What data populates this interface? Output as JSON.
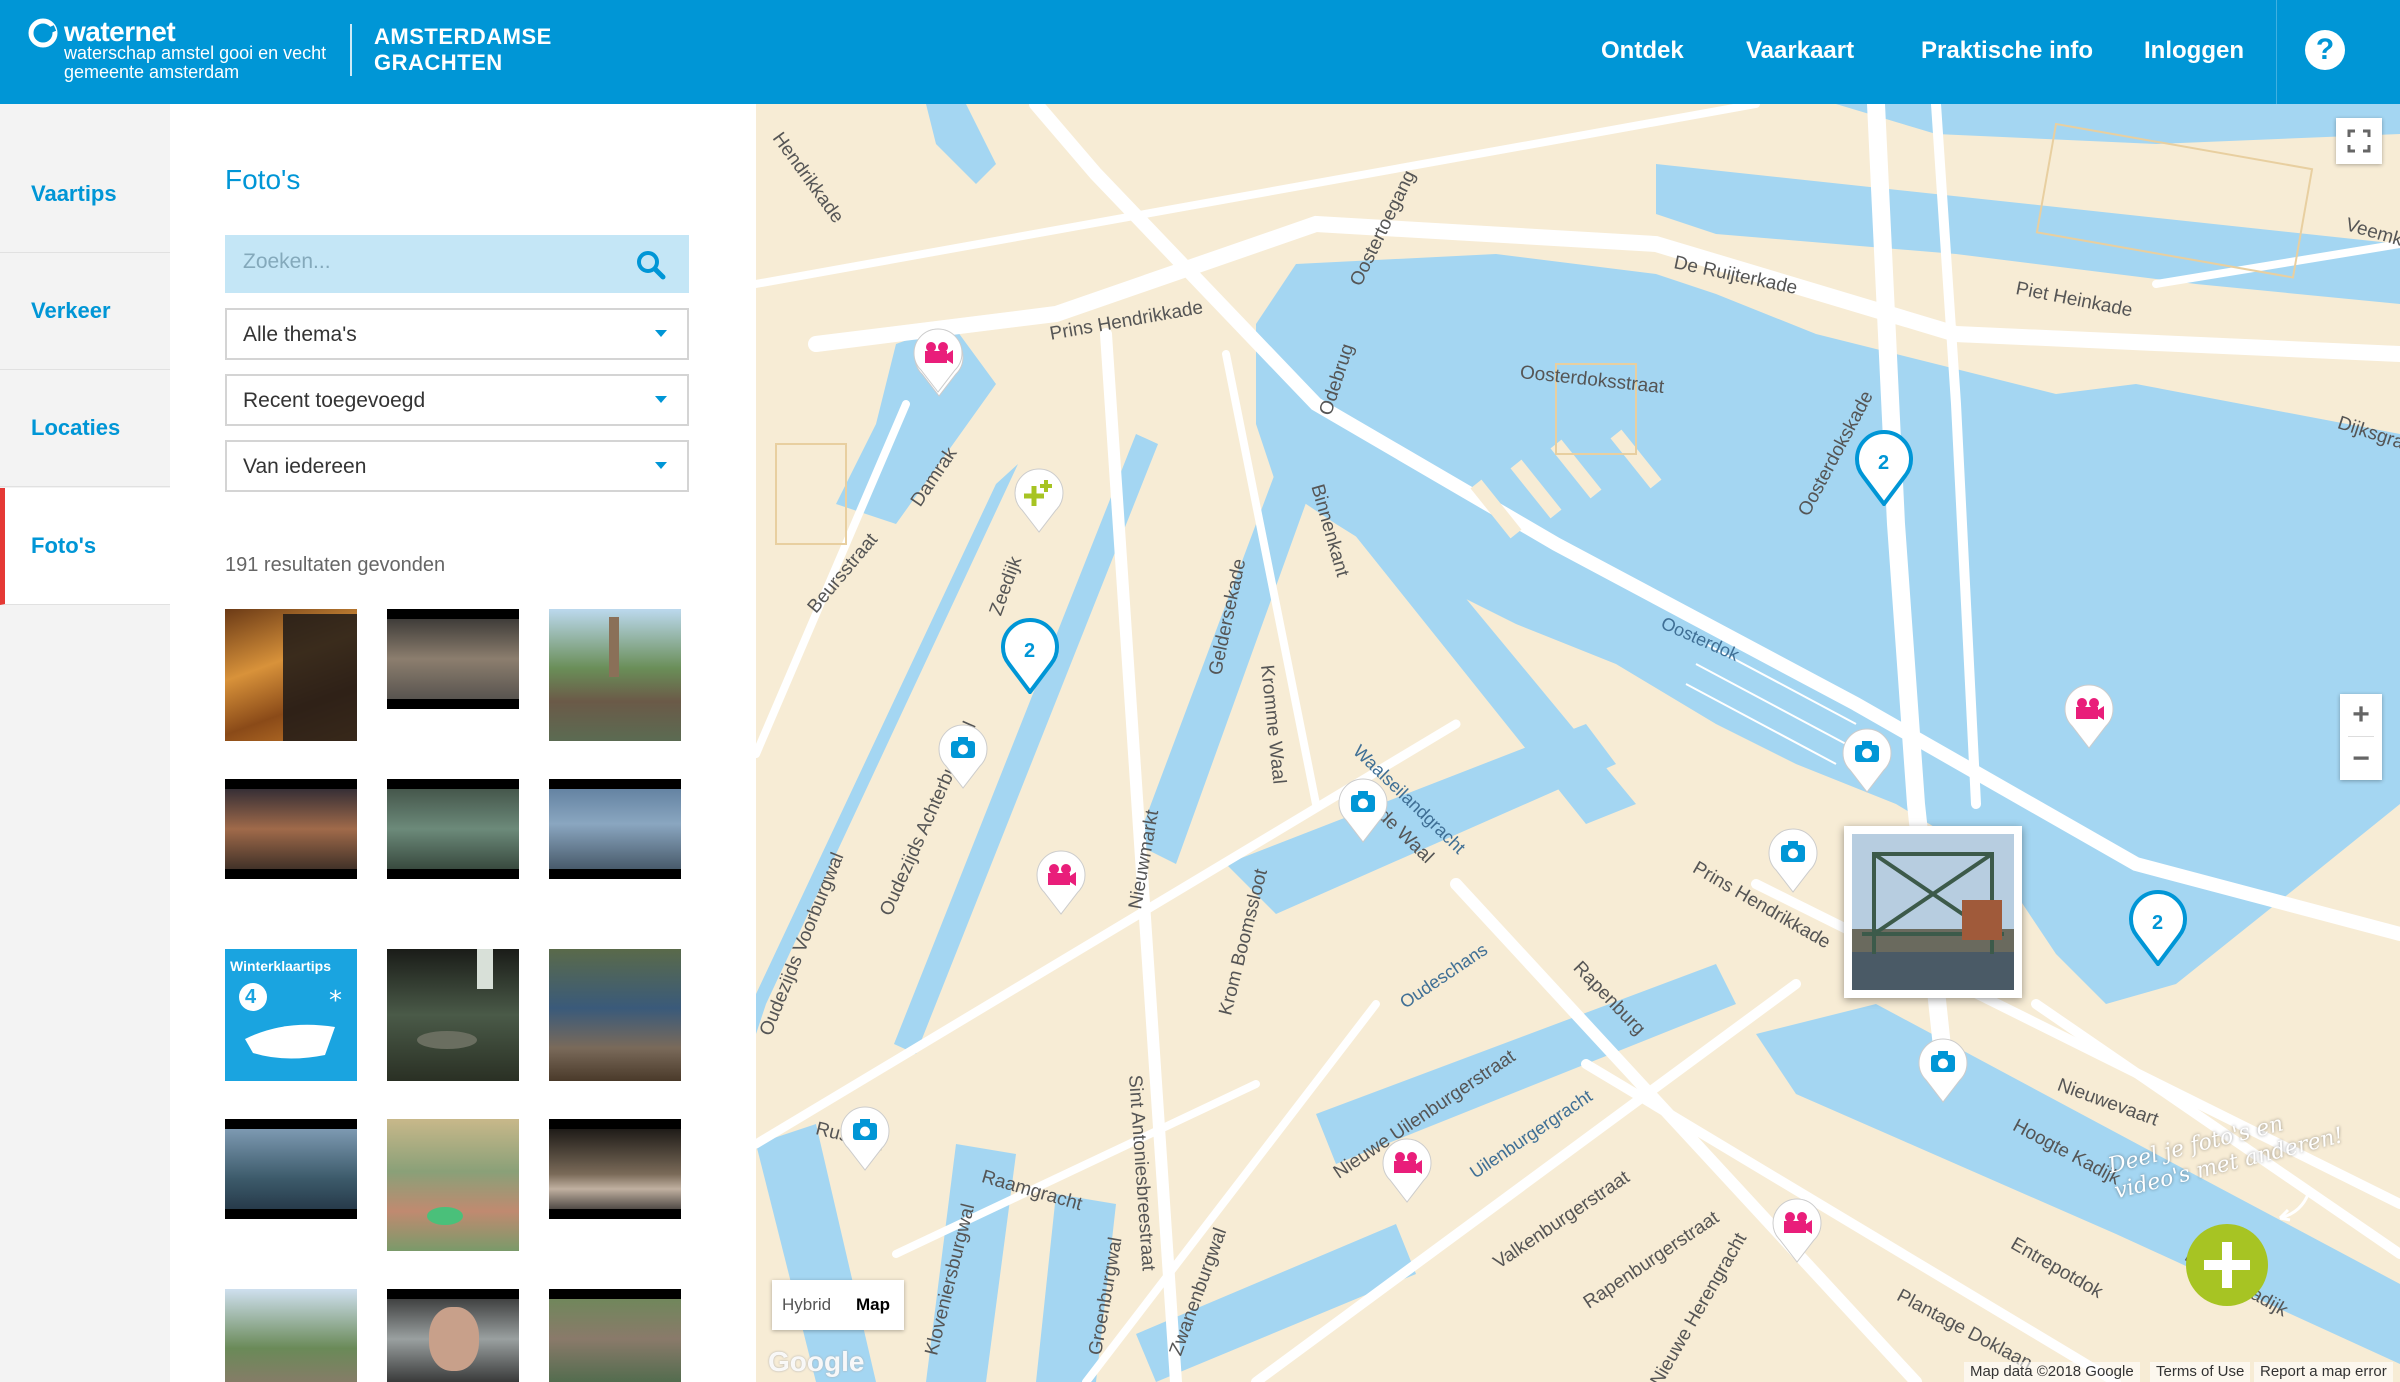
{
  "header": {
    "logo_name": "waternet",
    "logo_sub1": "waterschap amstel gooi en vecht",
    "logo_sub2": "gemeente amsterdam",
    "site_title_line1": "AMSTERDAMSE",
    "site_title_line2": "GRACHTEN",
    "nav": [
      "Ontdek",
      "Vaarkaart",
      "Praktische info",
      "Inloggen"
    ],
    "help": "?"
  },
  "tabs": [
    {
      "label": "Vaartips",
      "active": false
    },
    {
      "label": "Verkeer",
      "active": false
    },
    {
      "label": "Locaties",
      "active": false
    },
    {
      "label": "Foto's",
      "active": true
    }
  ],
  "panel": {
    "title": "Foto's",
    "search_placeholder": "Zoeken...",
    "filters": [
      "Alle thema's",
      "Recent toegevoegd",
      "Van iedereen"
    ],
    "results": "191 resultaten gevonden",
    "winter_tile_title": "Winterklaartips",
    "winter_tile_number": "4"
  },
  "map": {
    "streets": [
      "Prins Hendrikkade",
      "Damrak",
      "Beursstraat",
      "Oosterdoksstraat",
      "De Ruijterkade",
      "Piet Heinkade",
      "Oostertoegang",
      "Odebrug",
      "Binnenkant",
      "Kromme Waal",
      "Geldersekade",
      "Zeedijk",
      "Oudezijds Achterburgwal",
      "Oudezijds Voorburgwal",
      "Nieuwmarkt",
      "Sint Antoniesbreestraat",
      "Krom Boomssloot",
      "Waalseilandgracht",
      "Oude Waal",
      "Oudeschans",
      "Rapenburg",
      "Nieuwe Uilenburgerstraat",
      "Uilenburgergracht",
      "Valkenburgerstraat",
      "Rapenburgerstraat",
      "Nieuwe Herengracht",
      "Raamgracht",
      "Zwanenburgwal",
      "Groenburgwal",
      "Kloveniersburgwal",
      "Rusland",
      "Oosterdokskade",
      "Nieuwevaart",
      "Hoogte Kadijk",
      "Entrepotdok",
      "Plantage Doklaan",
      "Dijksgracht",
      "Veemkade",
      "Hendrikkade",
      "Laagte Kadijk",
      "Prins Hendrikkade"
    ],
    "water_labels": [
      "Oosterdok"
    ],
    "cluster_count": "2",
    "maptype_hybrid": "Hybrid",
    "maptype_map": "Map",
    "google": "Google",
    "attribution": [
      "Map data ©2018 Google",
      "Terms of Use",
      "Report a map error"
    ],
    "share_tip_line1": "Deel je foto's en",
    "share_tip_line2": "video's met anderen!",
    "zoom_in": "+",
    "zoom_out": "−"
  },
  "colors": {
    "brand_blue": "#0096d6",
    "water": "#a4d6f2",
    "land": "#f7ecd5",
    "video_pin": "#e91e7a",
    "add_green": "#a7c423",
    "active_tab_accent": "#e53935"
  }
}
